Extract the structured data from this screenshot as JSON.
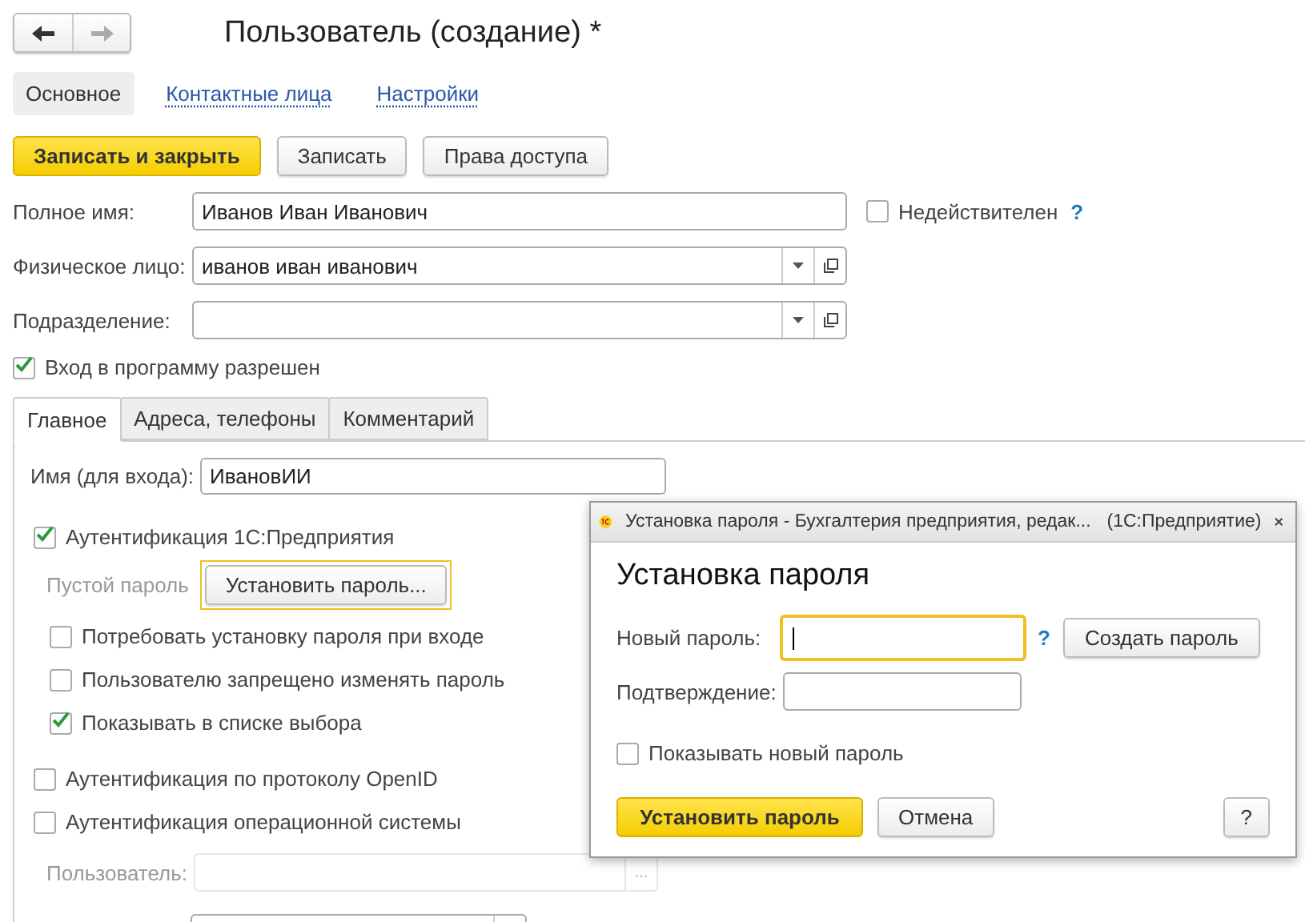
{
  "nav": {
    "back_disabled": false,
    "forward_disabled": true
  },
  "title": "Пользователь (создание) *",
  "sections": [
    {
      "label": "Основное",
      "selected": true
    },
    {
      "label": "Контактные лица",
      "selected": false
    },
    {
      "label": "Настройки",
      "selected": false
    }
  ],
  "toolbar": [
    {
      "label": "Записать и закрыть",
      "kind": "primary"
    },
    {
      "label": "Записать",
      "kind": "default"
    },
    {
      "label": "Права доступа",
      "kind": "default"
    }
  ],
  "fields": [
    {
      "label": "Полное имя:",
      "value": "Иванов Иван Иванович",
      "kind": "text"
    },
    {
      "label": "Физическое лицо:",
      "value": "иванов иван иванович",
      "kind": "select"
    },
    {
      "label": "Подразделение:",
      "kind": "select"
    }
  ],
  "invalid": {
    "label": "Недействителен",
    "checked": false,
    "help": "?"
  },
  "login_allowed": {
    "label": "Вход в программу разрешен",
    "checked": true
  },
  "tabs": [
    {
      "label": "Главное",
      "selected": true
    },
    {
      "label": "Адреса, телефоны",
      "selected": false
    },
    {
      "label": "Комментарий",
      "selected": false
    }
  ],
  "login_name": {
    "label": "Имя (для входа):",
    "value": "ИвановИИ"
  },
  "auth_1c": {
    "label": "Аутентификация 1С:Предприятия",
    "checked": true
  },
  "password_status": "Пустой пароль",
  "set_password_button": "Установить пароль...",
  "password_options": [
    {
      "label": "Потребовать установку пароля при входе",
      "checked": false
    },
    {
      "label": "Пользователю запрещено изменять пароль",
      "checked": false
    },
    {
      "label": "Показывать в списке выбора",
      "checked": true
    }
  ],
  "auth_other": [
    {
      "label": "Аутентификация по протоколу OpenID",
      "checked": false
    },
    {
      "label": "Аутентификация операционной системы",
      "checked": false
    }
  ],
  "os_user": {
    "label": "Пользователь:",
    "disabled": true,
    "button": "..."
  },
  "dialog": {
    "window_title": "Установка пароля - Бухгалтерия предприятия, редак...",
    "app_name": "(1С:Предприятие)",
    "heading": "Установка пароля",
    "new_password": {
      "label": "Новый пароль:",
      "help": "?",
      "focused": true
    },
    "generate_button": "Создать пароль",
    "confirm": {
      "label": "Подтверждение:"
    },
    "show_password": {
      "label": "Показывать новый пароль",
      "checked": false
    },
    "buttons": [
      {
        "label": "Установить пароль",
        "kind": "primary"
      },
      {
        "label": "Отмена",
        "kind": "default"
      },
      {
        "label": "?",
        "kind": "help"
      }
    ]
  }
}
